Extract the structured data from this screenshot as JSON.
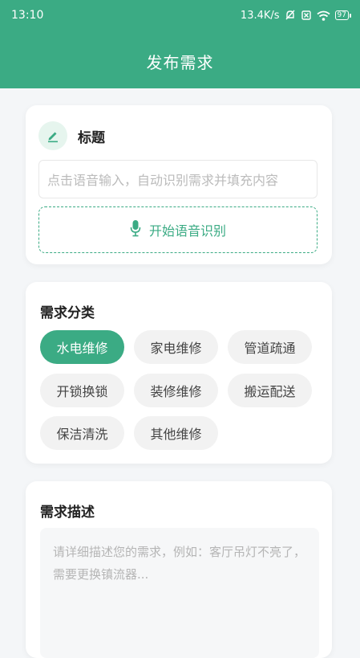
{
  "status_bar": {
    "time": "13:10",
    "network_speed": "13.4K/s",
    "battery": "97"
  },
  "header": {
    "title": "发布需求"
  },
  "title_section": {
    "label": "标题",
    "input_placeholder": "点击语音输入，自动识别需求并填充内容",
    "voice_button_label": "开始语音识别"
  },
  "category_section": {
    "label": "需求分类",
    "chips": [
      {
        "label": "水电维修",
        "selected": true
      },
      {
        "label": "家电维修",
        "selected": false
      },
      {
        "label": "管道疏通",
        "selected": false
      },
      {
        "label": "开锁换锁",
        "selected": false
      },
      {
        "label": "装修维修",
        "selected": false
      },
      {
        "label": "搬运配送",
        "selected": false
      },
      {
        "label": "保洁清洗",
        "selected": false
      },
      {
        "label": "其他维修",
        "selected": false
      }
    ]
  },
  "description_section": {
    "label": "需求描述",
    "placeholder": "请详细描述您的需求，例如：客厅吊灯不亮了，需要更换镇流器..."
  },
  "colors": {
    "accent": "#3bab84"
  }
}
